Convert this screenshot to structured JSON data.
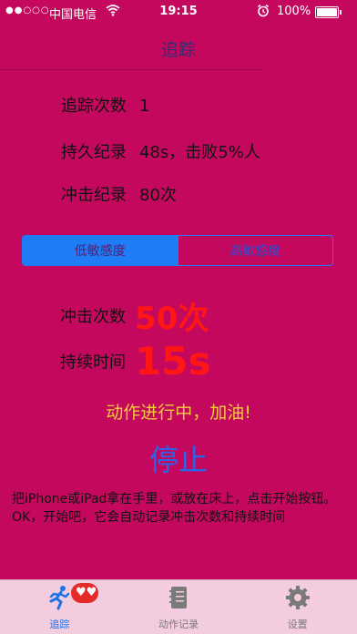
{
  "status_bar": {
    "carrier": "中国电信",
    "time": "19:15",
    "battery": "100%"
  },
  "nav": {
    "title": "追踪"
  },
  "stats": {
    "track_count_label": "追踪次数",
    "track_count_value": "1",
    "duration_record_label": "持久纪录",
    "duration_record_value": "48s，击败5%人",
    "impact_record_label": "冲击纪录",
    "impact_record_value": "80次"
  },
  "sensitivity": {
    "options": [
      "低敏感度",
      "高敏感度"
    ],
    "selected": "低敏感度"
  },
  "live": {
    "impact_label": "冲击次数",
    "impact_value": "50次",
    "duration_label": "持续时间",
    "duration_value": "15s"
  },
  "status_message": "动作进行中，加油!",
  "stop_label": "停止",
  "instructions": "把iPhone或iPad拿在手里，或放在床上，点击开始按钮。OK，开始吧，它会自动记录冲击次数和持续时间",
  "tabs": [
    {
      "label": "追踪",
      "icon": "runner-icon",
      "active": true
    },
    {
      "label": "动作记录",
      "icon": "notebook-icon",
      "active": false
    },
    {
      "label": "设置",
      "icon": "gear-icon",
      "active": false
    }
  ],
  "colors": {
    "background": "#c4085e",
    "accent": "#1e7cf6",
    "highlight": "#ff1616",
    "message": "#f0cc3a"
  }
}
